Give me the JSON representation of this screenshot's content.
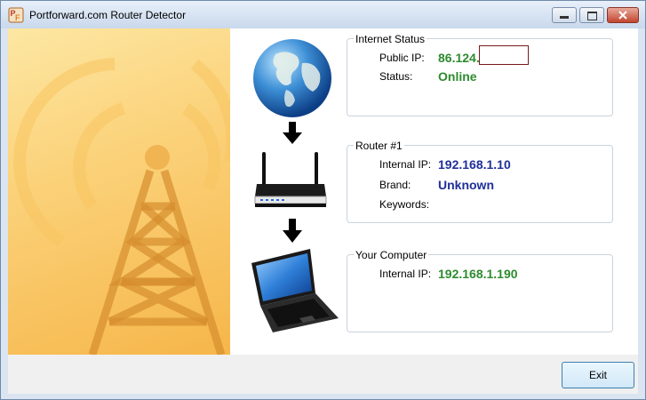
{
  "window": {
    "title": "Portforward.com Router Detector",
    "accent": "#2e8b2e"
  },
  "titlebar_buttons": {
    "minimize_icon": "minimize-icon",
    "maximize_icon": "maximize-icon",
    "close_icon": "close-icon"
  },
  "internet_status": {
    "group_title": "Internet Status",
    "public_ip_label": "Public IP:",
    "public_ip_value": "86.124.",
    "status_label": "Status:",
    "status_value": "Online"
  },
  "router": {
    "group_title": "Router #1",
    "internal_ip_label": "Internal IP:",
    "internal_ip_value": "192.168.1.10",
    "brand_label": "Brand:",
    "brand_value": "Unknown",
    "keywords_label": "Keywords:"
  },
  "computer": {
    "group_title": "Your Computer",
    "internal_ip_label": "Internal IP:",
    "internal_ip_value": "192.168.1.190"
  },
  "footer": {
    "exit_label": "Exit"
  },
  "colors": {
    "value_green": "#2e8b2e",
    "value_blue": "#1f2f9a"
  }
}
